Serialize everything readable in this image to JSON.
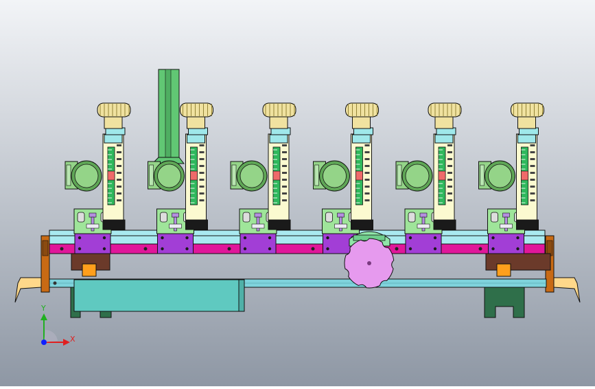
{
  "colors": {
    "bg_top": "#f2f4f7",
    "bg_bottom": "#8e97a4",
    "knob": "#f0e2a0",
    "knob_dark": "#8a7a2c",
    "tube_body": "#fbfad0",
    "tube_collar": "#9fe8ea",
    "tube_base": "#1a1a1a",
    "glass": "#2fb85c",
    "float": "#ef6a6a",
    "gauge": "#94d488",
    "gauge_ring": "#5fa656",
    "mount_block": "#9fe59a",
    "valve_block": "#a23ed6",
    "rail_teal": "#a9eaf0",
    "rail_magenta": "#e0179a",
    "end_bracket": "#c86a14",
    "long_tube": "#7fd3dc",
    "cylinder": "#5fc9c0",
    "support": "#2f6f4a",
    "foot": "#ffd88a",
    "dial": "#e69aee",
    "chimney": "#61c774",
    "sensor_purple": "#b48ee0",
    "slider": "#ff9f1c",
    "axis_x": "#e02020",
    "axis_y": "#20b020",
    "axis_origin": "#1020ff"
  },
  "flowmeter_count": 6,
  "icons": {
    "triad": "coordinate-triad-icon",
    "dial": "indexing-dial-icon"
  },
  "triad": {
    "x_label": "X",
    "y_label": "Y"
  }
}
